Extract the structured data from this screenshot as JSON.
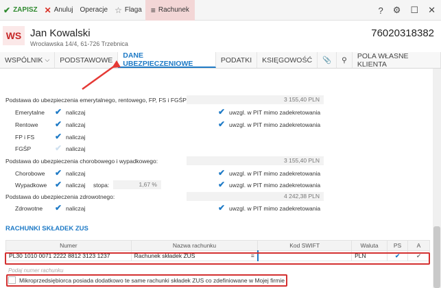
{
  "toolbar": {
    "save": "ZAPISZ",
    "cancel": "Anuluj",
    "operations": "Operacje",
    "flag": "Flaga",
    "account": "Rachunek"
  },
  "header": {
    "logo": "WS",
    "name": "Jan Kowalski",
    "address": "Wrocławska 14/4, 61-726 Trzebnica",
    "nip": "76020318382"
  },
  "tabs": [
    {
      "label": "WSPÓLNIK"
    },
    {
      "label": "PODSTAWOWE"
    },
    {
      "label": "DANE UBEZPIECZENIOWE"
    },
    {
      "label": "PODATKI"
    },
    {
      "label": "KSIĘGOWOŚĆ"
    },
    {
      "label": "POLA WŁASNE KLIENTA"
    }
  ],
  "insurance": {
    "base_emerytalne": "Podstawa do ubezpieczenia emerytalnego, rentowego, FP, FS i FGŚP:",
    "base_emerytalne_value": "3 155,40 PLN",
    "base_chorobowe": "Podstawa do ubezpieczenia chorobowego i wypadkowego:",
    "base_chorobowe_value": "3 155,40 PLN",
    "base_zdrowotne": "Podstawa do ubezpieczenia zdrowotnego:",
    "base_zdrowotne_value": "4 242,38 PLN",
    "rows": {
      "emerytalne": "Emerytalne",
      "rentowe": "Rentowe",
      "fp": "FP i FS",
      "fgsp": "FGŚP",
      "chorobowe": "Chorobowe",
      "wypadkowe": "Wypadkowe",
      "zdrowotne": "Zdrowotne"
    },
    "naliczaj": "naliczaj",
    "pit": "uwzgl. w PIT mimo zadekretowania",
    "stopa_label": "stopa:",
    "stopa_value": "1,67 %"
  },
  "zus": {
    "title": "RACHUNKI SKŁADEK ZUS",
    "columns": [
      "Numer",
      "Nazwa rachunku",
      "Kod SWIFT",
      "Waluta",
      "PS",
      "A"
    ],
    "row": {
      "numer": "PL30 1010 0071 2222 8812 3123 1237",
      "nazwa": "Rachunek składek ZUS",
      "swift": "",
      "waluta": "PLN"
    },
    "placeholder": "Podaj numer rachunku",
    "mikro": "Mikroprzedsiębiorca posiada dodatkowo te same rachunki składek ZUS co zdefiniowane w Mojej firmie"
  },
  "colors": {
    "accent": "#1e7ac6",
    "save": "#2f8a2f",
    "highlight": "#d32f2f"
  }
}
